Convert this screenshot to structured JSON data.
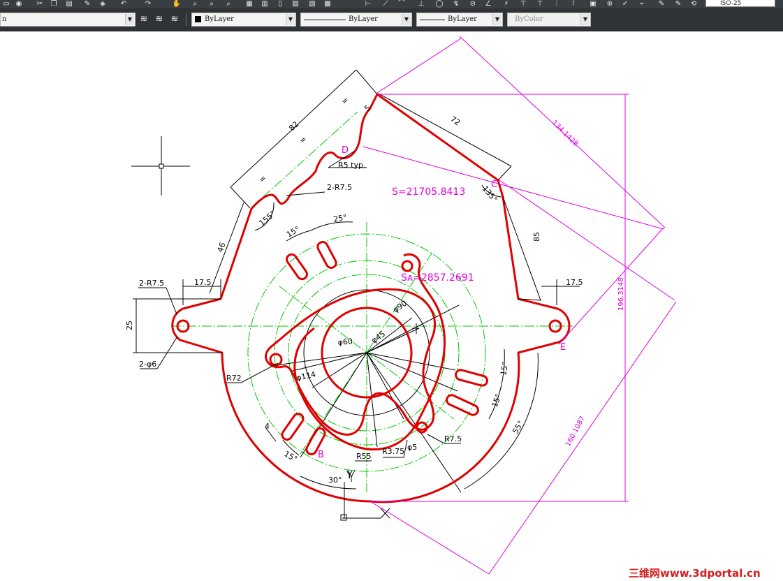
{
  "app": {
    "dimstyle_box": "ISO-25"
  },
  "properties_bar": {
    "layer_dropdown_value": "n",
    "color_dropdown_value": "ByLayer",
    "linetype_dropdown_value": "ByLayer",
    "lineweight_dropdown_value": "ByLayer",
    "plotstyle_dropdown_value": "ByColor"
  },
  "icons": {
    "tools": [
      "undo-icon",
      "redo-icon",
      "pan-icon",
      "zoom-realtime-icon",
      "zoom-window-icon",
      "zoom-previous-icon",
      "properties-icon",
      "design-center-icon",
      "tool-palettes-icon",
      "sheet-set-icon",
      "markup-icon",
      "quickcalc-icon"
    ],
    "layer_tools": [
      "layer-properties-icon",
      "layer-states-icon",
      "layer-previous-icon"
    ]
  },
  "drawing": {
    "area_label": "S=21705.8413",
    "area_shaded_label": "Sᴀ=2857.2691",
    "dims": {
      "d82": "82",
      "d72": "72",
      "d5": "5",
      "eq1": "=",
      "eq2": "=",
      "eq3": "=",
      "eq4": "=",
      "d46": "46",
      "d85": "85",
      "d17_5_left": "17.5",
      "d17_5_right": "17.5",
      "d25": "25",
      "r7_5_left": "2-R7.5",
      "phi6": "2-φ6",
      "r5typ": "R5 typ.",
      "r7_5_top": "2-R7.5",
      "a155": "155°",
      "a135": "135°",
      "a15_top": "15°",
      "a25_top": "25°",
      "a15_r1": "15°",
      "a15_r2": "15°",
      "a55": "55°",
      "a15_b": "15°",
      "a30": "30°",
      "d4": "4",
      "r72": "R72",
      "phi114": "φ114",
      "phi60": "φ60",
      "phi45": "φ45",
      "phi90": "φ90",
      "r55": "R55",
      "r3_75": "R3.75",
      "phi5": "φ5",
      "r7_5_b": "R7.5",
      "m134": "134.1428",
      "m196": "196.3148",
      "m160": "160.1087"
    },
    "points": {
      "b": "B",
      "c": "C",
      "d": "D",
      "e": "E"
    },
    "ucs": {
      "x": "X",
      "y": "Y"
    }
  },
  "watermark": "三维网www.3dportal.cn",
  "colors": {
    "outline": "#e00000",
    "centerline": "#00c800",
    "dimension": "#000000",
    "measure": "#e000e0",
    "toolbar": "#2f3336"
  }
}
